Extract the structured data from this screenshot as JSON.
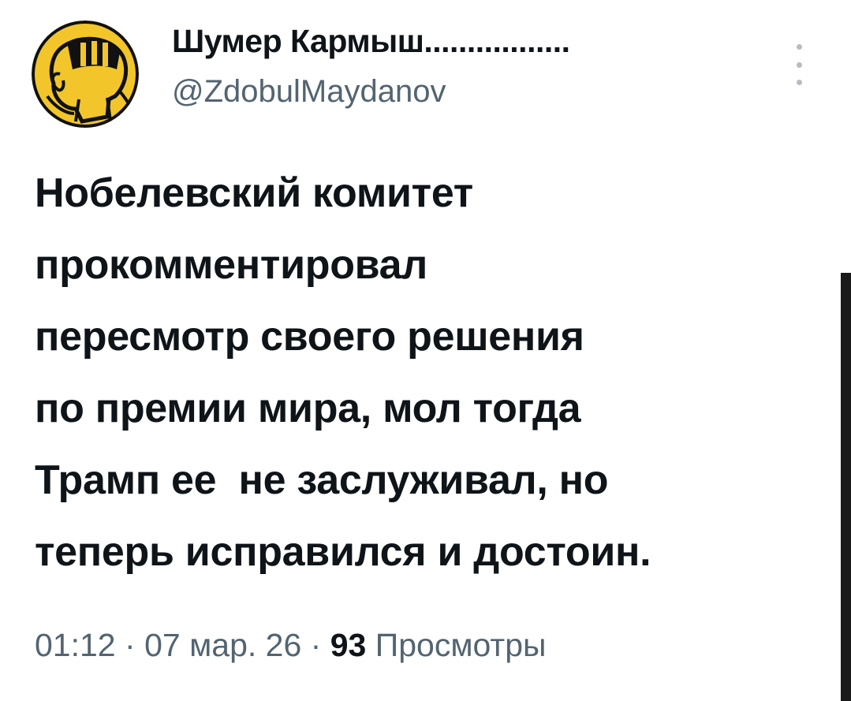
{
  "author": {
    "display_name": "Шумер Кармыш.................",
    "handle": "@ZdobulMaydanov",
    "avatar_icon": "striped-head-avatar-icon"
  },
  "tweet": {
    "lines": [
      "Нобелевский комитет",
      "прокомментировал",
      "пересмотр своего решения",
      "по премии мира, мол тогда",
      "Трамп ее  не заслуживал, но",
      "теперь исправился и достоин."
    ]
  },
  "meta": {
    "time": "01:12",
    "separator": "·",
    "date": "07 мар. 26",
    "views_count": "93",
    "views_label": "Просмотры"
  },
  "colors": {
    "text_primary": "#0f1419",
    "text_secondary": "#536471",
    "avatar_bg": "#f2c62a"
  }
}
